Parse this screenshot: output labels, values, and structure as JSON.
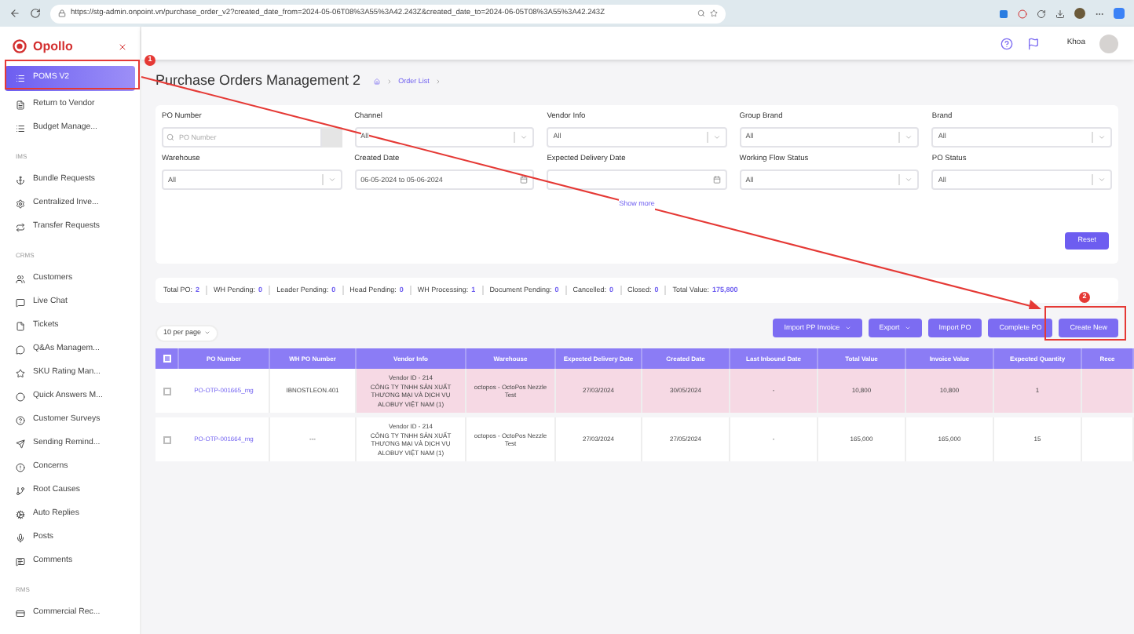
{
  "browser": {
    "url": "https://stg-admin.onpoint.vn/purchase_order_v2?created_date_from=2024-05-06T08%3A55%3A42.243Z&created_date_to=2024-06-05T08%3A55%3A42.243Z"
  },
  "sidebar": {
    "logo": "Opollo",
    "groups": [
      {
        "items": [
          {
            "label": "POMS V2",
            "selected": true
          },
          {
            "label": "Return to Vendor",
            "selected": false
          },
          {
            "label": "Budget Manage...",
            "selected": false
          }
        ]
      },
      {
        "heading": "IMS",
        "items": [
          {
            "label": "Bundle Requests",
            "selected": false
          },
          {
            "label": "Centralized Inve...",
            "selected": false
          },
          {
            "label": "Transfer Requests",
            "selected": false
          }
        ]
      },
      {
        "heading": "CRMS",
        "items": [
          {
            "label": "Customers",
            "selected": false
          },
          {
            "label": "Live Chat",
            "selected": false
          },
          {
            "label": "Tickets",
            "selected": false
          },
          {
            "label": "Q&As Managem...",
            "selected": false
          },
          {
            "label": "SKU Rating Man...",
            "selected": false
          },
          {
            "label": "Quick Answers M...",
            "selected": false
          },
          {
            "label": "Customer Surveys",
            "selected": false
          },
          {
            "label": "Sending Remind...",
            "selected": false
          },
          {
            "label": "Concerns",
            "selected": false
          },
          {
            "label": "Root Causes",
            "selected": false
          },
          {
            "label": "Auto Replies",
            "selected": false
          },
          {
            "label": "Posts",
            "selected": false
          },
          {
            "label": "Comments",
            "selected": false
          }
        ]
      },
      {
        "heading": "RMS",
        "items": [
          {
            "label": "Commercial Rec...",
            "selected": false
          }
        ]
      }
    ]
  },
  "header": {
    "user": "Khoa"
  },
  "page": {
    "title": "Purchase Orders Management 2",
    "breadcrumb": [
      "Order List"
    ]
  },
  "filters": [
    {
      "label": "PO Number",
      "kind": "search",
      "placeholder": "PO Number"
    },
    {
      "label": "Channel",
      "kind": "select",
      "value": "All"
    },
    {
      "label": "Vendor Info",
      "kind": "select",
      "value": "All"
    },
    {
      "label": "Group Brand",
      "kind": "select",
      "value": "All"
    },
    {
      "label": "Brand",
      "kind": "select",
      "value": "All"
    },
    {
      "label": "Warehouse",
      "kind": "select",
      "value": "All"
    },
    {
      "label": "Created Date",
      "kind": "date",
      "value": "06-05-2024 to 05-06-2024"
    },
    {
      "label": "Expected Delivery Date",
      "kind": "date"
    },
    {
      "label": "Working Flow Status",
      "kind": "select",
      "value": "All"
    },
    {
      "label": "PO Status",
      "kind": "select",
      "value": "All"
    }
  ],
  "show_more": "Show more",
  "reset_button": "Reset",
  "stats": [
    {
      "label": "Total PO:",
      "value": "2"
    },
    {
      "label": "WH Pending:",
      "value": "0"
    },
    {
      "label": "Leader Pending:",
      "value": "0"
    },
    {
      "label": "Head Pending:",
      "value": "0"
    },
    {
      "label": "WH Processing:",
      "value": "1"
    },
    {
      "label": "Document Pending:",
      "value": "0"
    },
    {
      "label": "Cancelled:",
      "value": "0"
    },
    {
      "label": "Closed:",
      "value": "0"
    },
    {
      "label": "Total Value:",
      "value": "175,800"
    }
  ],
  "page_size": "10 per page",
  "actions": [
    {
      "label": "Import PP Invoice",
      "dropdown": true
    },
    {
      "label": "Export",
      "dropdown": true
    },
    {
      "label": "Import PO",
      "dropdown": false
    },
    {
      "label": "Complete PO",
      "dropdown": false
    },
    {
      "label": "Create New",
      "dropdown": false
    }
  ],
  "table": {
    "all_checked": false,
    "columns": [
      "PO Number",
      "WH PO Number",
      "Vendor Info",
      "Warehouse",
      "Expected Delivery Date",
      "Created Date",
      "Last Inbound Date",
      "Total Value",
      "Invoice Value",
      "Expected Quantity",
      "Rece"
    ],
    "rows": [
      {
        "highlighted": true,
        "checked": false,
        "cells": [
          "PO-OTP-001665_mg",
          "IBNOSTLEON.401",
          "Vendor ID - 214\nCÔNG TY TNHH SẢN XUẤT THƯƠNG MẠI VÀ DỊCH VỤ ALOBUY VIỆT NAM (1)",
          "octopos - OctoPos Nezzle Test",
          "27/03/2024",
          "30/05/2024",
          "-",
          "10,800",
          "10,800",
          "1",
          ""
        ]
      },
      {
        "highlighted": false,
        "checked": false,
        "cells": [
          "PO-OTP-001664_mg",
          "---",
          "Vendor ID - 214\nCÔNG TY TNHH SẢN XUẤT THƯƠNG MẠI VÀ DỊCH VỤ ALOBUY VIỆT NAM (1)",
          "octopos - OctoPos Nezzle Test",
          "27/03/2024",
          "27/05/2024",
          "-",
          "165,000",
          "165,000",
          "15",
          ""
        ]
      }
    ]
  },
  "annotations": [
    "1",
    "2"
  ]
}
